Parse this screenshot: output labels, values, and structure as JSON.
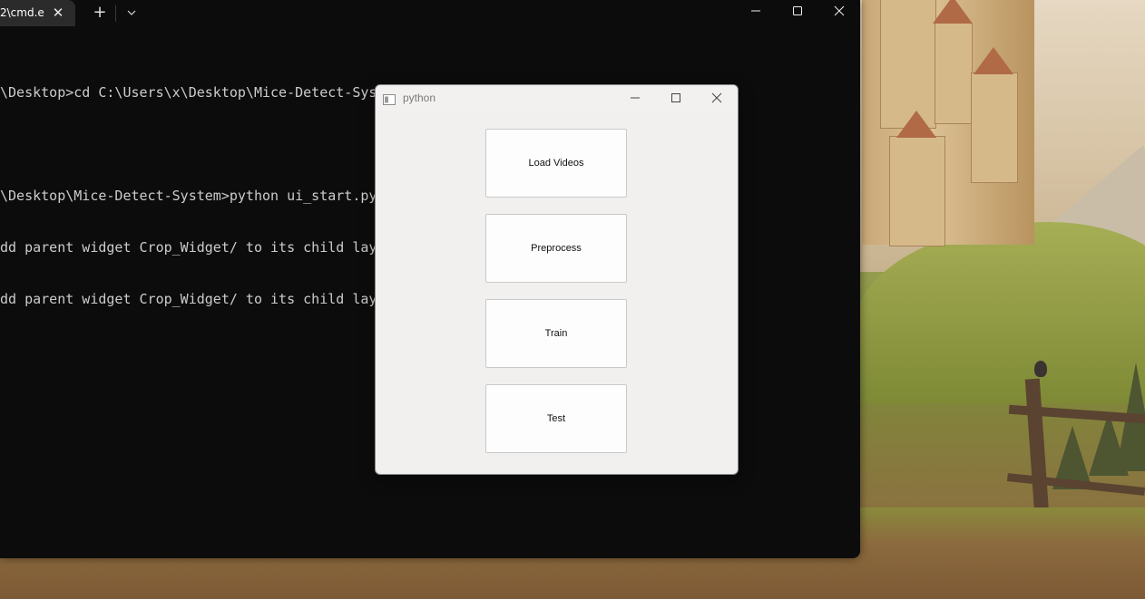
{
  "terminal": {
    "tab_title": "2\\cmd.e",
    "tab_close_glyph": "✕",
    "new_tab_glyph": "+",
    "lines": [
      "\\Desktop>cd C:\\Users\\x\\Desktop\\Mice-Detect-System",
      "",
      "\\Desktop\\Mice-Detect-System>python ui_start.py",
      "dd parent widget Crop_Widget/ to its child layout",
      "dd parent widget Crop_Widget/ to its child layout"
    ],
    "icons": {
      "minimize": "minimize-icon",
      "maximize": "maximize-icon",
      "close": "close-icon",
      "dropdown": "chevron-down-icon"
    }
  },
  "python_window": {
    "title": "python",
    "buttons": {
      "load_videos": "Load Videos",
      "preprocess": "Preprocess",
      "train": "Train",
      "test": "Test"
    }
  },
  "colors": {
    "terminal_bg": "#0c0c0c",
    "terminal_text": "#cccccc",
    "window_bg": "#f2f0ef"
  }
}
